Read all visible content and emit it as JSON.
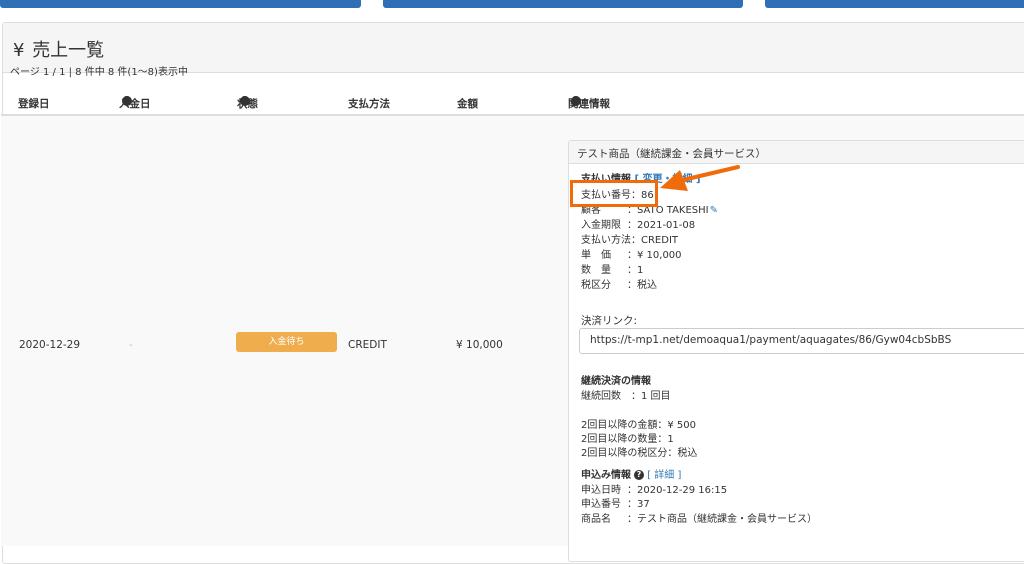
{
  "page": {
    "title": "売上一覧",
    "pager_text": "ページ 1 / 1 | 8 件中 8 件(1〜8)表示中"
  },
  "table": {
    "columns": {
      "registered": "登録日",
      "paid_date": "入金日",
      "status": "状態",
      "method": "支払方法",
      "amount": "金額",
      "related": "関連情報"
    },
    "row": {
      "registered": "2020-12-29",
      "paid_date": "-",
      "status": "入金待ち",
      "method": "CREDIT",
      "amount": "¥ 10,000"
    }
  },
  "info": {
    "title": "テスト商品（継続課金・会員サービス）",
    "payment_header": "支払い情報",
    "payment_header_link": "[ 変更・詳細 ]",
    "payment_number": "支払い番号：86",
    "customer_label": "顧客",
    "customer_value": "：SATO TAKESHI",
    "due_label": "入金期限",
    "due_value": "：2021-01-08",
    "method_label": "支払い方法",
    "method_value": "：CREDIT",
    "unit_label": "単　価",
    "unit_value": "：¥ 10,000",
    "qty_label": "数　量",
    "qty_value": "：1",
    "tax_label": "税区分",
    "tax_value": "：税込",
    "link_label": "決済リンク:",
    "link_url": "https://t-mp1.net/demoaqua1/payment/aquagates/86/Gyw04cbSbBS",
    "recurring_header": "継続決済の情報",
    "recurring_count": "継続回数　：1 回目",
    "second_amount": "2回目以降の金額：¥ 500",
    "second_qty": "2回目以降の数量：1",
    "second_tax": "2回目以降の税区分：税込",
    "apply_header": "申込み情報",
    "apply_link": "詳細",
    "apply_date_label": "申込日時",
    "apply_date_value": "：2020-12-29 16:15",
    "apply_no_label": "申込番号",
    "apply_no_value": "：37",
    "product_label": "商品名",
    "product_value": "：テスト商品（継続課金・会員サービス）"
  },
  "colors": {
    "highlight": "#f06b0a",
    "badge": "#f0ad4e",
    "link": "#337ab7",
    "top_button": "#2f6fb5"
  }
}
